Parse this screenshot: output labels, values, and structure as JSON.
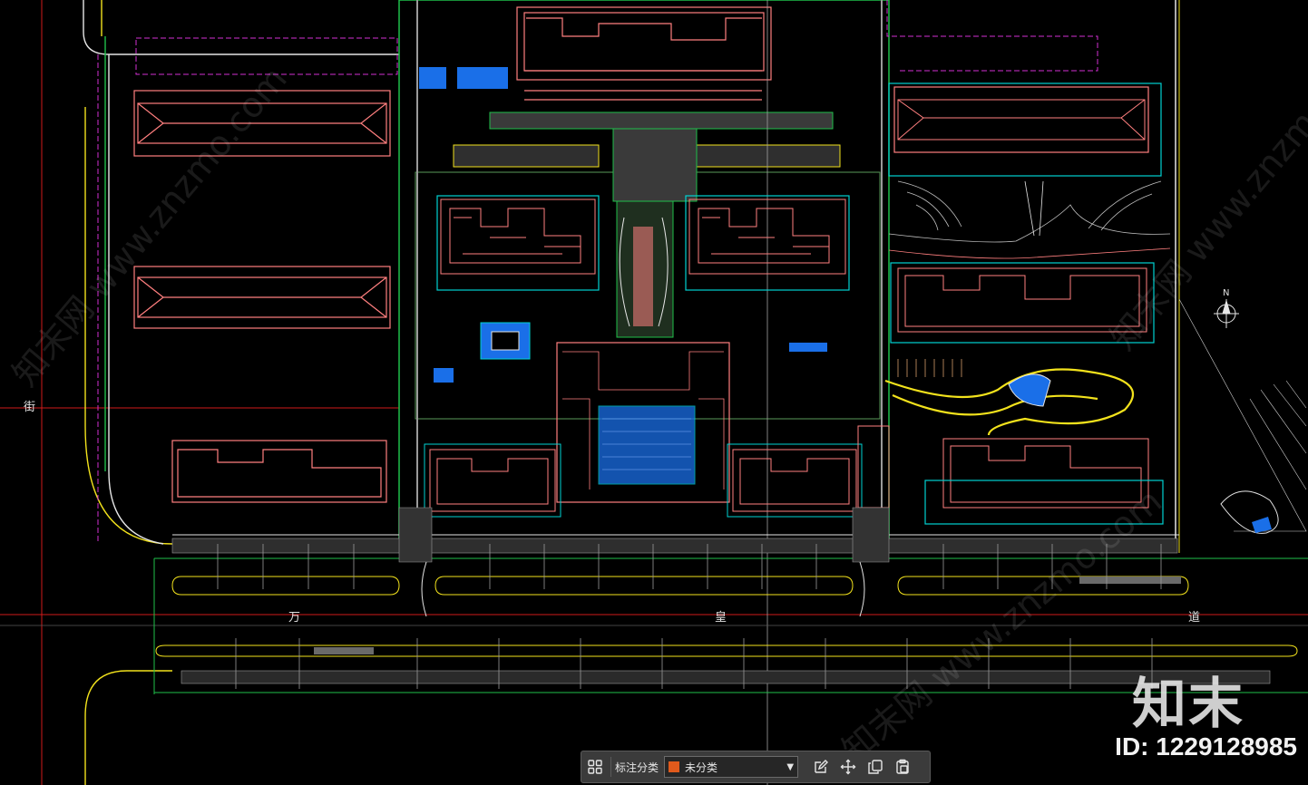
{
  "drawing": {
    "street_labels": {
      "vertical": "街",
      "road_char_1": "万",
      "road_char_2": "皇",
      "road_char_3": "道"
    },
    "compass": {
      "north": "N"
    },
    "colors": {
      "background": "#000000",
      "salmon": "#ff7f7f",
      "cyan": "#00d2d2",
      "green": "#1fbf4a",
      "yellow": "#f2e21c",
      "magenta": "#d22fd2",
      "blue": "#1a6fe8",
      "grey_fill": "#3a3a3a",
      "red_line": "#d11a1a"
    }
  },
  "watermark": {
    "brand": "知末",
    "id_label": "ID: 1229128985",
    "diagonal_text": "知末网 www.znzmo.com"
  },
  "toolbar": {
    "label": "标注分类",
    "select_value": "未分类",
    "select_color": "#e05a1c",
    "icons": [
      "grid-icon",
      "edit-icon",
      "move-icon",
      "copy-icon",
      "paste-icon"
    ]
  }
}
